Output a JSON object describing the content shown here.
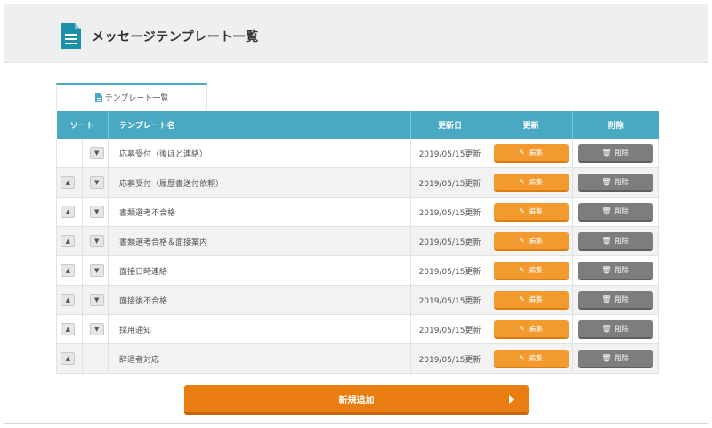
{
  "header": {
    "title": "メッセージテンプレート一覧",
    "icon": "document-icon"
  },
  "tab": {
    "label": "テンプレート一覧",
    "icon": "document-icon"
  },
  "table": {
    "columns": {
      "sort": "ソート",
      "name": "テンプレート名",
      "updated": "更新日",
      "update": "更新",
      "delete": "削除"
    },
    "rows": [
      {
        "name": "応募受付（後ほど連絡）",
        "date": "2019/05/15更新",
        "up": false,
        "down": true
      },
      {
        "name": "応募受付（履歴書送付依頼）",
        "date": "2019/05/15更新",
        "up": true,
        "down": true
      },
      {
        "name": "書類選考不合格",
        "date": "2019/05/15更新",
        "up": true,
        "down": true
      },
      {
        "name": "書類選考合格＆面接案内",
        "date": "2019/05/15更新",
        "up": true,
        "down": true
      },
      {
        "name": "面接日時連絡",
        "date": "2019/05/15更新",
        "up": true,
        "down": true
      },
      {
        "name": "面接後不合格",
        "date": "2019/05/15更新",
        "up": true,
        "down": true
      },
      {
        "name": "採用通知",
        "date": "2019/05/15更新",
        "up": true,
        "down": true
      },
      {
        "name": "辞退者対応",
        "date": "2019/05/15更新",
        "up": true,
        "down": false
      }
    ],
    "edit_label": "編集",
    "delete_label": "削除"
  },
  "new_button": {
    "label": "新規追加"
  },
  "colors": {
    "accent": "#4aa9c2",
    "edit": "#f39a2e",
    "delete": "#7d7d7d",
    "primary_action": "#ea7d12"
  }
}
